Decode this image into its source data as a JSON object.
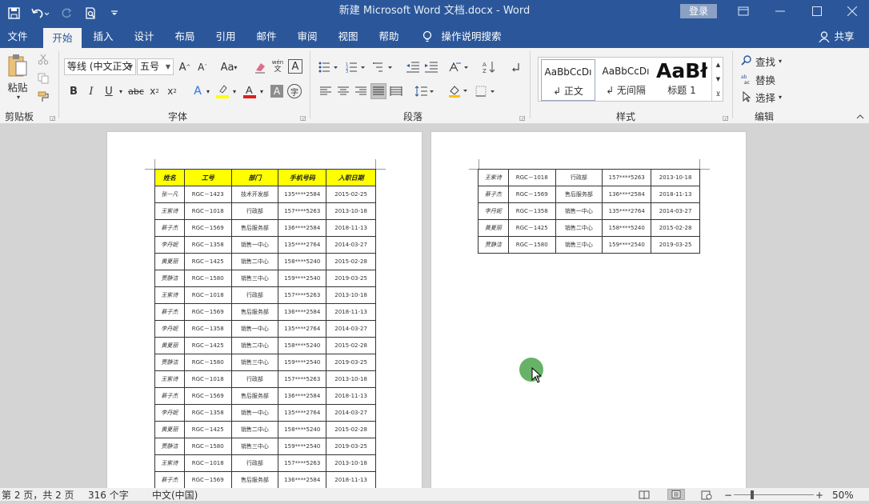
{
  "window": {
    "title": "新建 Microsoft Word 文档.docx  -  Word",
    "login_label": "登录"
  },
  "tabs": [
    "文件",
    "开始",
    "插入",
    "设计",
    "布局",
    "引用",
    "邮件",
    "审阅",
    "视图",
    "帮助"
  ],
  "tell_me": "操作说明搜索",
  "share_label": "共享",
  "ribbon": {
    "clipboard": {
      "paste_label": "粘贴",
      "group_label": "剪贴板"
    },
    "font": {
      "font_name": "等线 (中文正文",
      "font_size": "五号",
      "group_label": "字体"
    },
    "paragraph": {
      "group_label": "段落"
    },
    "styles": {
      "group_label": "样式",
      "items": [
        {
          "preview": "AaBbCcDı",
          "name": "↲ 正文"
        },
        {
          "preview": "AaBbCcDı",
          "name": "↲ 无间隔"
        },
        {
          "preview": "AaBł",
          "name": "标题 1"
        }
      ]
    },
    "editing": {
      "find": "查找",
      "replace": "替换",
      "select": "选择",
      "group_label": "编辑"
    }
  },
  "table_headers": [
    "姓名",
    "工号",
    "部门",
    "手机号码",
    "入职日期"
  ],
  "page1_rows": [
    [
      "张一凡",
      "RGC－1423",
      "技术开发部",
      "135****2584",
      "2015-02-25"
    ],
    [
      "王紫诗",
      "RGC－1018",
      "行政部",
      "157****5263",
      "2013-10-18"
    ],
    [
      "蔡子杰",
      "RGC－1569",
      "售后服务部",
      "136****2584",
      "2018-11-13"
    ],
    [
      "李丹妮",
      "RGC－1358",
      "销售一中心",
      "135****2764",
      "2014-03-27"
    ],
    [
      "黄夏丽",
      "RGC－1425",
      "销售二中心",
      "158****5240",
      "2015-02-28"
    ],
    [
      "贾静洁",
      "RGC－1580",
      "销售三中心",
      "159****2540",
      "2019-03-25"
    ],
    [
      "王紫诗",
      "RGC－1018",
      "行政部",
      "157****5263",
      "2013-10-18"
    ],
    [
      "蔡子杰",
      "RGC－1569",
      "售后服务部",
      "136****2584",
      "2018-11-13"
    ],
    [
      "李丹妮",
      "RGC－1358",
      "销售一中心",
      "135****2764",
      "2014-03-27"
    ],
    [
      "黄夏丽",
      "RGC－1425",
      "销售二中心",
      "158****5240",
      "2015-02-28"
    ],
    [
      "贾静洁",
      "RGC－1580",
      "销售三中心",
      "159****2540",
      "2019-03-25"
    ],
    [
      "王紫诗",
      "RGC－1018",
      "行政部",
      "157****5263",
      "2013-10-18"
    ],
    [
      "蔡子杰",
      "RGC－1569",
      "售后服务部",
      "136****2584",
      "2018-11-13"
    ],
    [
      "李丹妮",
      "RGC－1358",
      "销售一中心",
      "135****2764",
      "2014-03-27"
    ],
    [
      "黄夏丽",
      "RGC－1425",
      "销售二中心",
      "158****5240",
      "2015-02-28"
    ],
    [
      "贾静洁",
      "RGC－1580",
      "销售三中心",
      "159****2540",
      "2019-03-25"
    ],
    [
      "王紫诗",
      "RGC－1018",
      "行政部",
      "157****5263",
      "2013-10-18"
    ],
    [
      "蔡子杰",
      "RGC－1569",
      "售后服务部",
      "136****2584",
      "2018-11-13"
    ]
  ],
  "page2_rows": [
    [
      "王紫诗",
      "RGC－1018",
      "行政部",
      "157****5263",
      "2013-10-18"
    ],
    [
      "蔡子杰",
      "RGC－1569",
      "售后服务部",
      "136****2584",
      "2018-11-13"
    ],
    [
      "李丹妮",
      "RGC－1358",
      "销售一中心",
      "135****2764",
      "2014-03-27"
    ],
    [
      "黄夏丽",
      "RGC－1425",
      "销售二中心",
      "158****5240",
      "2015-02-28"
    ],
    [
      "贾静洁",
      "RGC－1580",
      "销售三中心",
      "159****2540",
      "2019-03-25"
    ]
  ],
  "status": {
    "page": "第 2 页，共 2 页",
    "words": "316 个字",
    "language": "中文(中国)",
    "zoom": "50%"
  }
}
